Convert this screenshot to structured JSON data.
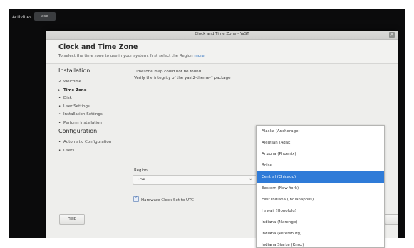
{
  "topbar": {
    "activities": "Activities",
    "app_label": "ase"
  },
  "window": {
    "title": "Clock and Time Zone - YaST",
    "close_symbol": "×"
  },
  "header": {
    "title": "Clock and Time Zone",
    "subtitle": "To select the time zone to use in your system, first select the Region",
    "more_link": "more"
  },
  "sidebar": {
    "installation_heading": "Installation",
    "installation_items": [
      {
        "mark": "✓",
        "label": "Welcome"
      },
      {
        "mark": "▸",
        "label": "Time Zone"
      },
      {
        "mark": "•",
        "label": "Disk"
      },
      {
        "mark": "•",
        "label": "User Settings"
      },
      {
        "mark": "•",
        "label": "Installation Settings"
      },
      {
        "mark": "•",
        "label": "Perform Installation"
      }
    ],
    "configuration_heading": "Configuration",
    "configuration_items": [
      {
        "mark": "•",
        "label": "Automatic Configuration"
      },
      {
        "mark": "•",
        "label": "Users"
      }
    ]
  },
  "content": {
    "map_error_line1": "Timezone map could not be found.",
    "map_error_line2": "Verify the integrity of the yast2-theme-* package"
  },
  "region": {
    "label": "Region",
    "value": "USA"
  },
  "hardware_clock": {
    "label": "Hardware Clock Set to UTC",
    "checked": true
  },
  "buttons": {
    "help": "Help"
  },
  "timezone_list": {
    "options": [
      "Alaska (Anchorage)",
      "Aleutian (Adak)",
      "Arizona (Phoenix)",
      "Boise",
      "Central (Chicago)",
      "Eastern (New York)",
      "East Indiana (Indianapolis)",
      "Hawaii (Honolulu)",
      "Indiana (Marengo)",
      "Indiana (Petersburg)",
      "Indiana Starke (Knox)"
    ],
    "selected": "Central (Chicago)"
  },
  "colors": {
    "selection": "#2f7bd8",
    "link": "#2a6fbf",
    "desktop": "#0b0b0c"
  }
}
